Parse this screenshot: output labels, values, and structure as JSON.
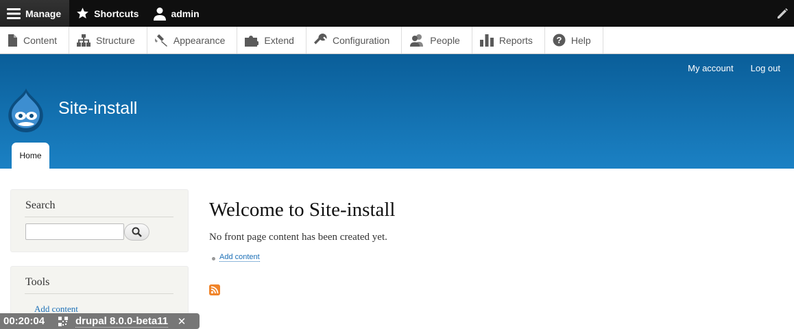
{
  "toolbar": {
    "manage": "Manage",
    "shortcuts": "Shortcuts",
    "user": "admin"
  },
  "admin_menu": [
    {
      "label": "Content",
      "icon": "page-icon"
    },
    {
      "label": "Structure",
      "icon": "sitemap-icon"
    },
    {
      "label": "Appearance",
      "icon": "paintbrush-icon"
    },
    {
      "label": "Extend",
      "icon": "puzzle-icon"
    },
    {
      "label": "Configuration",
      "icon": "wrench-icon"
    },
    {
      "label": "People",
      "icon": "people-icon"
    },
    {
      "label": "Reports",
      "icon": "bar-chart-icon"
    },
    {
      "label": "Help",
      "icon": "help-icon"
    }
  ],
  "header": {
    "my_account": "My account",
    "log_out": "Log out",
    "site_name": "Site-install",
    "tab_home": "Home"
  },
  "sidebar": {
    "search_title": "Search",
    "search_value": "",
    "tools_title": "Tools",
    "tools_link": "Add content"
  },
  "main": {
    "title": "Welcome to Site-install",
    "intro": "No front page content has been created yet.",
    "add_content": "Add content"
  },
  "overlay": {
    "time": "00:20:04",
    "label": "drupal 8.0.0-beta11",
    "close": "✕"
  },
  "colors": {
    "header_top": "#0a5e99",
    "header_bottom": "#1b81c4",
    "link": "#1d70b7",
    "rss": "#f0842a"
  }
}
